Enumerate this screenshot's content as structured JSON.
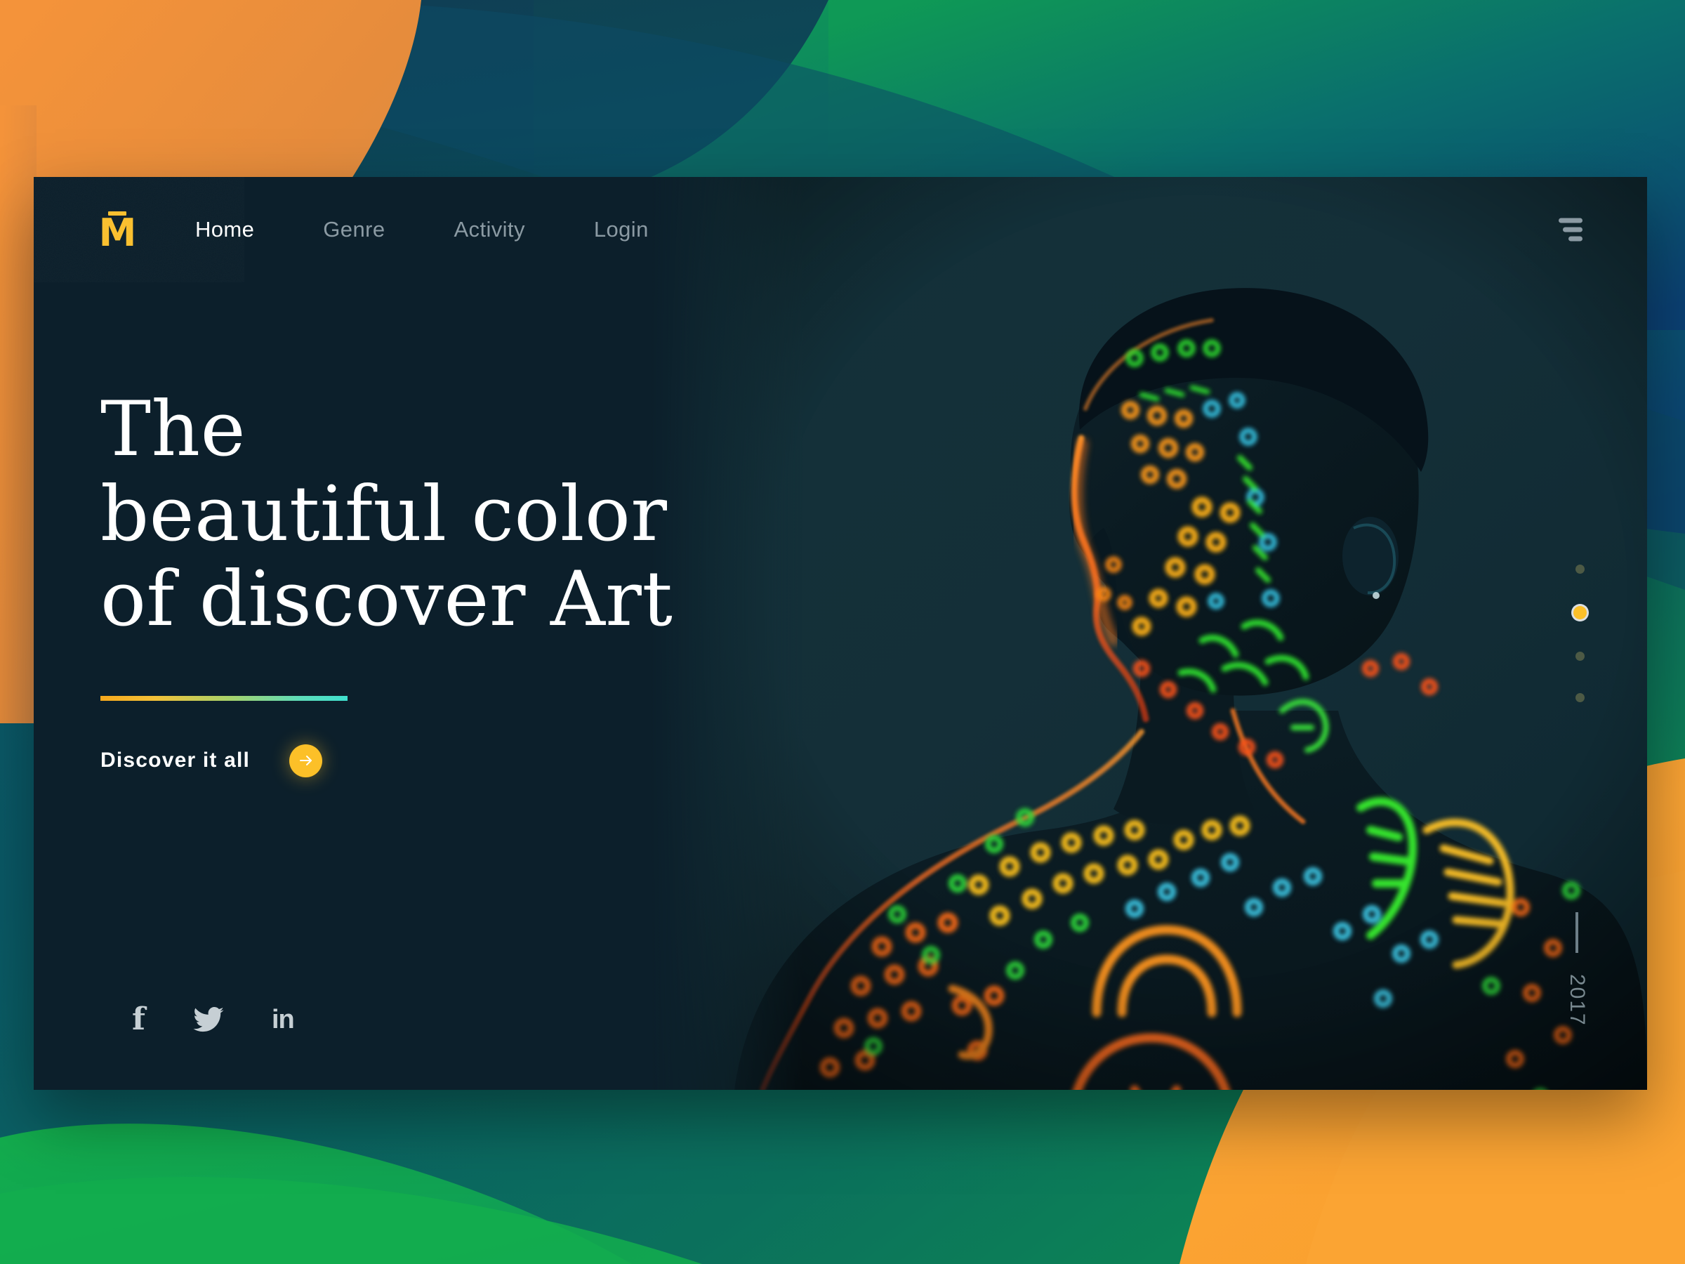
{
  "brand": {
    "logo_letter": "M",
    "logo_name": "logo-m-mark"
  },
  "nav": {
    "items": [
      {
        "label": "Home",
        "active": true
      },
      {
        "label": "Genre",
        "active": false
      },
      {
        "label": "Activity",
        "active": false
      },
      {
        "label": "Login",
        "active": false
      }
    ],
    "menu_icon": "hamburger-menu-icon"
  },
  "hero": {
    "headline_line1": "The",
    "headline_line2": "beautiful color",
    "headline_line3": "of discover Art",
    "cta_label": "Discover it all",
    "cta_arrow": "arrow-right-icon"
  },
  "social": [
    {
      "name": "facebook",
      "glyph": "f"
    },
    {
      "name": "twitter",
      "glyph": "twitter-bird-icon"
    },
    {
      "name": "linkedin",
      "glyph": "in"
    }
  ],
  "slider": {
    "total": 4,
    "active_index": 2,
    "dots": [
      {
        "index": 1,
        "active": false
      },
      {
        "index": 2,
        "active": true
      },
      {
        "index": 3,
        "active": false
      },
      {
        "index": 4,
        "active": false
      }
    ]
  },
  "footer_meta": {
    "year": "2017"
  },
  "colors": {
    "accent_yellow": "#fcc028",
    "card_bg": "#0c1f2b",
    "nav_inactive": "#8b9aa3",
    "nav_active": "#ffffff",
    "divider_from": "#f6a81c",
    "divider_to": "#3fe0cf",
    "bg_orange": "#f2912f",
    "bg_green": "#12a94c",
    "bg_teal": "#0b6b5f",
    "bg_blue": "#0d3c6b"
  }
}
